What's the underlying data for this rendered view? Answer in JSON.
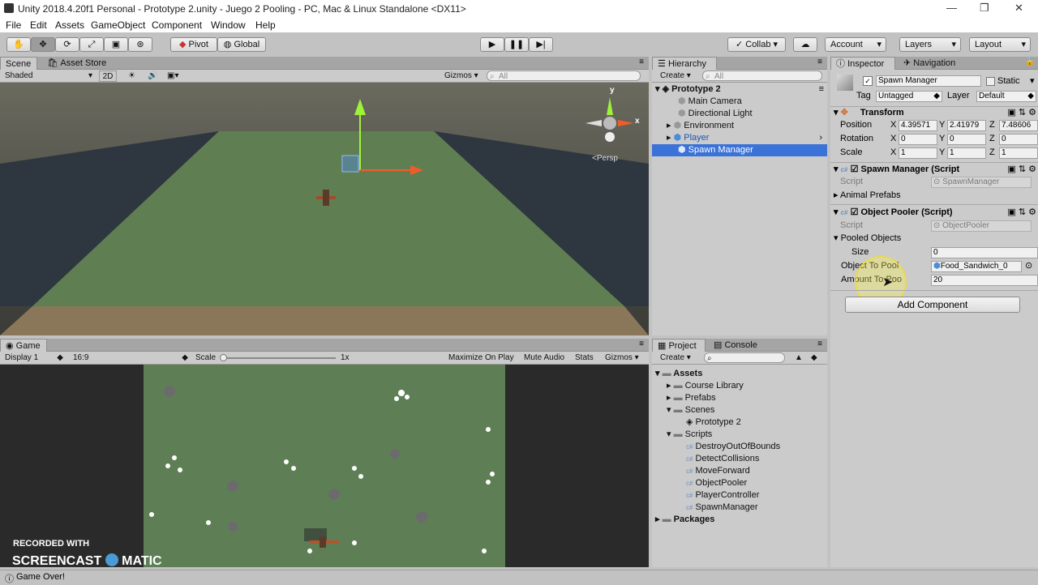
{
  "window": {
    "title": "Unity 2018.4.20f1 Personal - Prototype 2.unity - Juego 2 Pooling - PC, Mac & Linux Standalone <DX11>",
    "minimize": "—",
    "maximize": "❐",
    "close": "✕"
  },
  "menu": [
    "File",
    "Edit",
    "Assets",
    "GameObject",
    "Component",
    "Window",
    "Help"
  ],
  "toolbar": {
    "pivot": "Pivot",
    "global": "Global",
    "collab": "Collab ▾",
    "account": "Account",
    "layers": "Layers",
    "layout": "Layout"
  },
  "scene": {
    "tabs": [
      "Scene",
      "Asset Store"
    ],
    "shading": "Shaded",
    "mode2d": "2D",
    "gizmos": "Gizmos",
    "search_placeholder": "All",
    "persp": "<Persp",
    "axis_x": "x",
    "axis_y": "y"
  },
  "hierarchy": {
    "tab": "Hierarchy",
    "create": "Create",
    "search_placeholder": "All",
    "root": "Prototype 2",
    "items": [
      "Main Camera",
      "Directional Light",
      "Environment",
      "Player",
      "Spawn Manager"
    ]
  },
  "inspector": {
    "tabs": [
      "Inspector",
      "Navigation"
    ],
    "object_name": "Spawn Manager",
    "static": "Static",
    "tag_label": "Tag",
    "tag": "Untagged",
    "layer_label": "Layer",
    "layer": "Default",
    "transform": {
      "title": "Transform",
      "position": {
        "label": "Position",
        "x": "4.39571",
        "y": "2.41979",
        "z": "7.48606"
      },
      "rotation": {
        "label": "Rotation",
        "x": "0",
        "y": "0",
        "z": "0"
      },
      "scale": {
        "label": "Scale",
        "x": "1",
        "y": "1",
        "z": "1"
      },
      "axis_x": "X",
      "axis_y": "Y",
      "axis_z": "Z"
    },
    "spawn_manager": {
      "title": "Spawn Manager (Script",
      "script_label": "Script",
      "script_value": "SpawnManager",
      "animal_prefabs": "Animal Prefabs"
    },
    "object_pooler": {
      "title": "Object Pooler (Script)",
      "script_label": "Script",
      "script_value": "ObjectPooler",
      "pooled_objects": "Pooled Objects",
      "size_label": "Size",
      "size": "0",
      "object_to_pool_label": "Object To Pool",
      "object_to_pool": "Food_Sandwich_0",
      "amount_label": "Amount To Poo",
      "amount": "20"
    },
    "add_component": "Add Component"
  },
  "game": {
    "tab": "Game",
    "display": "Display 1",
    "aspect": "16:9",
    "scale_label": "Scale",
    "scale_value": "1x",
    "maximize": "Maximize On Play",
    "mute": "Mute Audio",
    "stats": "Stats",
    "gizmos": "Gizmos"
  },
  "project": {
    "tabs": [
      "Project",
      "Console"
    ],
    "create": "Create",
    "assets": "Assets",
    "folders": [
      "Course Library",
      "Prefabs",
      "Scenes",
      "Prototype 2",
      "Scripts",
      "DestroyOutOfBounds",
      "DetectCollisions",
      "MoveForward",
      "ObjectPooler",
      "PlayerController",
      "SpawnManager",
      "Packages"
    ]
  },
  "watermark": {
    "line1": "RECORDED WITH",
    "line2a": "SCREENCAST",
    "line2b": "MATIC"
  },
  "status": "Game Over!"
}
